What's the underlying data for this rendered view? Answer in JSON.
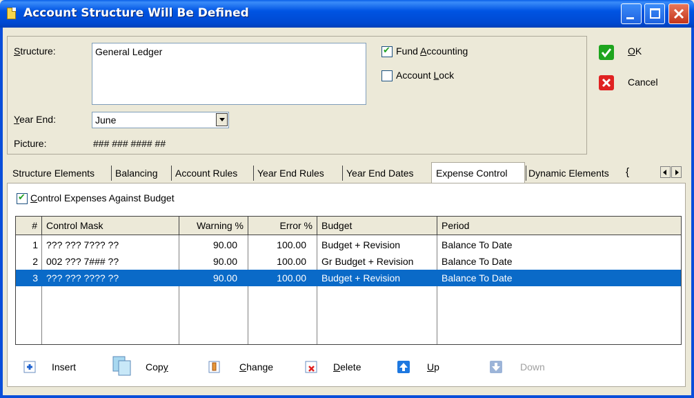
{
  "window": {
    "title": "Account Structure Will Be Defined"
  },
  "form": {
    "structure_label": "Structure:",
    "structure_value": "General Ledger",
    "year_end_label": "Year End:",
    "year_end_value": "June",
    "picture_label": "Picture:",
    "picture_value": "### ### #### ##",
    "fund_accounting_label": "Fund Accounting",
    "fund_accounting_checked": true,
    "account_lock_label": "Account Lock",
    "account_lock_checked": false
  },
  "actions": {
    "ok_label": "OK",
    "cancel_label": "Cancel"
  },
  "tabs": [
    {
      "label": "Structure Elements"
    },
    {
      "label": "Balancing"
    },
    {
      "label": "Account Rules"
    },
    {
      "label": "Year End Rules"
    },
    {
      "label": "Year End Dates"
    },
    {
      "label": "Expense Control",
      "active": true
    },
    {
      "label": "Dynamic Elements"
    }
  ],
  "expense": {
    "control_label": "Control Expenses Against Budget",
    "control_checked": true,
    "columns": [
      "#",
      "Control Mask",
      "Warning %",
      "Error %",
      "Budget",
      "Period"
    ],
    "rows": [
      {
        "num": "1",
        "mask": "??? ??? 7??? ??",
        "warning": "90.00",
        "error": "100.00",
        "budget": "Budget + Revision",
        "period": "Balance To Date"
      },
      {
        "num": "2",
        "mask": "002 ??? 7### ??",
        "warning": "90.00",
        "error": "100.00",
        "budget": "Gr Budget + Revision",
        "period": "Balance To Date"
      },
      {
        "num": "3",
        "mask": "??? ??? ???? ??",
        "warning": "90.00",
        "error": "100.00",
        "budget": "Budget + Revision",
        "period": "Balance To Date",
        "selected": true
      }
    ]
  },
  "toolbar": {
    "insert_label": "Insert",
    "copy_label": "Copy",
    "change_label": "Change",
    "delete_label": "Delete",
    "up_label": "Up",
    "down_label": "Down"
  },
  "colors": {
    "titlebar": "#0054E3",
    "selection": "#0A6AC8",
    "window_bg": "#ECE9D8"
  }
}
